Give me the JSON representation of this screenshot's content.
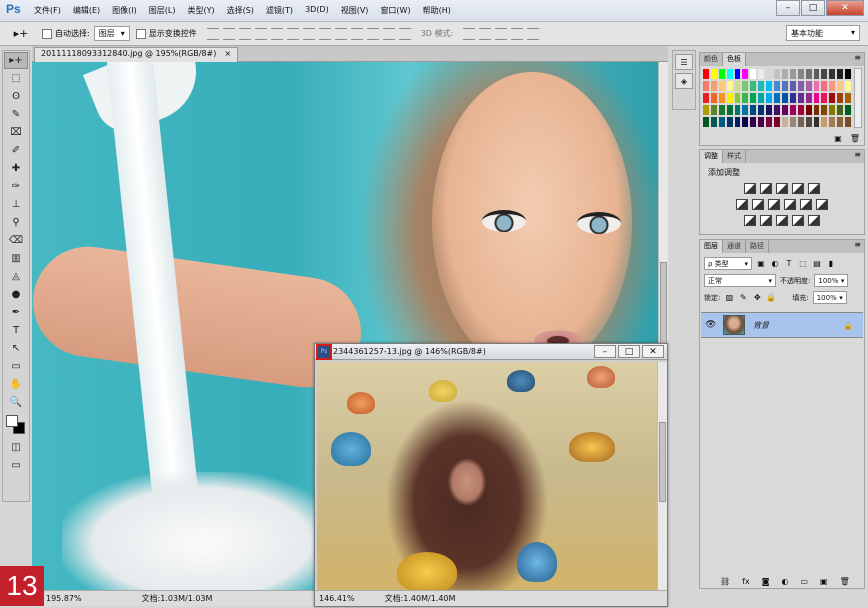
{
  "app": {
    "logo": "Ps"
  },
  "menu": [
    "文件(F)",
    "编辑(E)",
    "图像(I)",
    "图层(L)",
    "类型(Y)",
    "选择(S)",
    "滤镜(T)",
    "3D(D)",
    "视图(V)",
    "窗口(W)",
    "帮助(H)"
  ],
  "window_controls": {
    "minimize": "–",
    "restore": "□",
    "close": "✕"
  },
  "options": {
    "tool_glyph": "▸+",
    "auto_select_label": "自动选择:",
    "auto_select_value": "图层",
    "show_transform_label": "显示变换控件",
    "mode_3d_label": "3D 模式:",
    "workspace": "基本功能"
  },
  "doc1": {
    "tab_title": "20111118093312840.jpg @ 195%(RGB/8#)",
    "tab_close": "×",
    "zoom": "195.87%",
    "docsize": "文档:1.03M/1.03M"
  },
  "doc2": {
    "icon_label": "Ps",
    "title": "2344361257-13.jpg @ 146%(RGB/8#)",
    "zoom": "146.41%",
    "docsize": "文档:1.40M/1.40M",
    "btn_min": "–",
    "btn_max": "□",
    "btn_close": "✕"
  },
  "badge": "13",
  "tools": [
    "▸+",
    "⬚",
    "ʘ",
    "✎",
    "⌧",
    "✐",
    "✚",
    "✑",
    "⊥",
    "⚲",
    "⌫",
    "▥",
    "◬",
    "●",
    "✒",
    "T",
    "↖",
    "▭",
    "✋",
    "🔍"
  ],
  "panels": {
    "menu_glyph": "≡",
    "swatches_tabs": [
      "颜色",
      "色板"
    ],
    "adjust_tabs": [
      "调整",
      "样式"
    ],
    "adjust_title": "添加调整",
    "layers_tabs": [
      "图层",
      "通道",
      "路径"
    ],
    "kind_filter": "ρ 类型",
    "blend_mode": "正常",
    "opacity_label": "不透明度:",
    "opacity_value": "100%",
    "lock_label": "锁定:",
    "fill_label": "填充:",
    "fill_value": "100%",
    "layer_name": "背景"
  },
  "colors": {
    "swatches": [
      "#ff0000",
      "#ffff00",
      "#00ff00",
      "#00ffff",
      "#0000ff",
      "#ff00ff",
      "#ffffff",
      "#ebebeb",
      "#d6d6d6",
      "#c2c2c2",
      "#adadad",
      "#999999",
      "#858585",
      "#707070",
      "#5c5c5c",
      "#474747",
      "#333333",
      "#1f1f1f",
      "#000000",
      "#f27b6b",
      "#f59e6f",
      "#fbc77b",
      "#fff68f",
      "#c5df87",
      "#7cc576",
      "#3cb878",
      "#1cbbb4",
      "#00bff3",
      "#448ccb",
      "#5574b9",
      "#605ca8",
      "#855fa8",
      "#a763a8",
      "#f06eaa",
      "#f26d7d",
      "#f7977a",
      "#fdc68a",
      "#fff799",
      "#ed1c24",
      "#f26522",
      "#f7941d",
      "#fff200",
      "#8dc63f",
      "#39b54a",
      "#00a651",
      "#00a99d",
      "#00aeef",
      "#0072bc",
      "#0054a6",
      "#2e3192",
      "#662d91",
      "#92278f",
      "#ec008c",
      "#ed145b",
      "#9e0b0f",
      "#a0410d",
      "#a36209",
      "#aba000",
      "#598527",
      "#1a7b30",
      "#007236",
      "#00746b",
      "#0076a3",
      "#004b80",
      "#003471",
      "#1b1464",
      "#440e62",
      "#630460",
      "#9e005d",
      "#9e0039",
      "#790000",
      "#7b2e00",
      "#7d4900",
      "#827b00",
      "#406618",
      "#005e20",
      "#005826",
      "#005952",
      "#005b7f",
      "#003663",
      "#002157",
      "#0d004c",
      "#32004b",
      "#4b0049",
      "#7b0046",
      "#7a0026",
      "#c7b299",
      "#998675",
      "#736357",
      "#534741",
      "#37302a",
      "#c69c6d",
      "#a67c52",
      "#8c6239",
      "#754c24"
    ]
  }
}
